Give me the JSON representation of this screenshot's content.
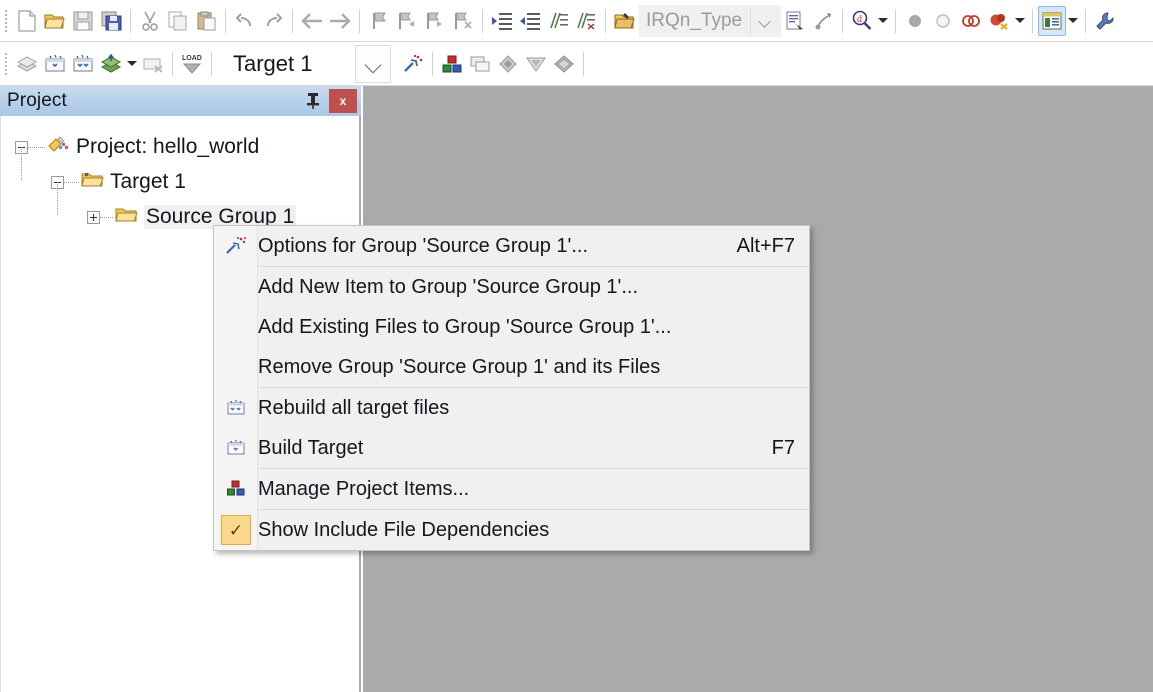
{
  "toolbar_top": {
    "buttons": [
      {
        "name": "new-file-icon",
        "label": "New"
      },
      {
        "name": "open-file-icon",
        "label": "Open"
      },
      {
        "name": "save-icon",
        "label": "Save"
      },
      {
        "name": "save-all-icon",
        "label": "Save All"
      },
      {
        "name": "cut-icon",
        "label": "Cut"
      },
      {
        "name": "copy-icon",
        "label": "Copy"
      },
      {
        "name": "paste-icon",
        "label": "Paste"
      },
      {
        "name": "undo-icon",
        "label": "Undo"
      },
      {
        "name": "redo-icon",
        "label": "Redo"
      },
      {
        "name": "navigate-back-icon",
        "label": "Back"
      },
      {
        "name": "navigate-forward-icon",
        "label": "Forward"
      },
      {
        "name": "bookmark-toggle-icon",
        "label": "Insert/Remove Bookmark"
      },
      {
        "name": "bookmark-prev-icon",
        "label": "Previous Bookmark"
      },
      {
        "name": "bookmark-next-icon",
        "label": "Next Bookmark"
      },
      {
        "name": "bookmark-clear-icon",
        "label": "Clear All Bookmarks"
      },
      {
        "name": "indent-right-icon",
        "label": "Indent Selected Text"
      },
      {
        "name": "indent-left-icon",
        "label": "Unindent Selected Text"
      },
      {
        "name": "comment-icon",
        "label": "Comment Selection"
      },
      {
        "name": "uncomment-icon",
        "label": "Uncomment Selection"
      },
      {
        "name": "open-browse-icon",
        "label": "Browse"
      }
    ],
    "symbol_combo": {
      "value": "IRQn_Type",
      "dropdown_name": "symbol-dropdown-arrow"
    },
    "after_combo_buttons": [
      {
        "name": "goto-definition-icon",
        "label": "Go To Definition"
      },
      {
        "name": "back-to-reference-icon",
        "label": "Back to Reference"
      }
    ],
    "find_button": {
      "name": "find-in-files-icon",
      "label": "Find in Files"
    },
    "debug_buttons": [
      {
        "name": "breakpoint-disabled-icon",
        "label": "Insert/Remove Breakpoint"
      },
      {
        "name": "breakpoint-toggle-icon",
        "label": "Enable/Disable Breakpoint"
      },
      {
        "name": "breakpoints-disable-all-icon",
        "label": "Disable All Breakpoints"
      },
      {
        "name": "breakpoints-kill-all-icon",
        "label": "Kill All Breakpoints"
      }
    ],
    "window-manager-button": {
      "name": "manage-windows-icon",
      "label": "Manage Windows",
      "active": true
    },
    "configure-button": {
      "name": "configure-wrench-icon",
      "label": "Configuration Wizard"
    }
  },
  "toolbar_second": {
    "buttons": [
      {
        "name": "translate-icon",
        "label": "Translate"
      },
      {
        "name": "build-icon",
        "label": "Build"
      },
      {
        "name": "rebuild-icon",
        "label": "Rebuild"
      },
      {
        "name": "batch-build-icon",
        "label": "Batch Build"
      },
      {
        "name": "stop-build-icon",
        "label": "Stop Build"
      },
      {
        "name": "download-icon",
        "label": "Download"
      }
    ],
    "target_combo": {
      "value": "Target 1",
      "dropdown_name": "target-dropdown-arrow"
    },
    "after_target_buttons": [
      {
        "name": "target-options-icon",
        "label": "Options for Target"
      },
      {
        "name": "manage-project-items-icon",
        "label": "Manage Project Items"
      },
      {
        "name": "multi-project-icon",
        "label": "Multi-Project"
      },
      {
        "name": "pack-installer-icon",
        "label": "Pack Installer"
      },
      {
        "name": "manage-run-time-env-icon",
        "label": "Manage Run-Time Environment"
      },
      {
        "name": "select-software-packs-icon",
        "label": "Select Software Packs"
      }
    ]
  },
  "project_panel": {
    "title": "Project",
    "pin_icon": "pin-icon",
    "close_label": "x",
    "tree": [
      {
        "label": "Project: hello_world",
        "icon": "project-icon",
        "expander": "minus",
        "level": 0
      },
      {
        "label": "Target 1",
        "icon": "target-folder-icon",
        "expander": "minus",
        "level": 1
      },
      {
        "label": "Source Group 1",
        "icon": "folder-icon",
        "expander": "plus",
        "level": 2,
        "selected": true
      }
    ]
  },
  "context_menu": {
    "items": [
      {
        "label": "Options for Group 'Source Group 1'...",
        "shortcut": "Alt+F7",
        "icon": "options-wand-icon",
        "type": "item"
      },
      {
        "type": "separator"
      },
      {
        "label": "Add New  Item to Group 'Source Group 1'...",
        "shortcut": "",
        "icon": "",
        "type": "item"
      },
      {
        "label": "Add Existing Files to Group 'Source Group 1'...",
        "shortcut": "",
        "icon": "",
        "type": "item"
      },
      {
        "label": "Remove Group 'Source Group 1' and its Files",
        "shortcut": "",
        "icon": "",
        "type": "item"
      },
      {
        "type": "separator"
      },
      {
        "label": "Rebuild all target files",
        "shortcut": "",
        "icon": "rebuild-icon",
        "type": "item"
      },
      {
        "label": "Build Target",
        "shortcut": "F7",
        "icon": "build-icon",
        "type": "item"
      },
      {
        "type": "separator"
      },
      {
        "label": "Manage Project Items...",
        "shortcut": "",
        "icon": "manage-project-items-icon",
        "type": "item"
      },
      {
        "type": "separator"
      },
      {
        "label": "Show Include File Dependencies",
        "shortcut": "",
        "icon": "checkmark-icon",
        "type": "checked",
        "checkmark": "✓"
      }
    ]
  },
  "colors": {
    "titlebar_accent": "#b7d0ea",
    "close_button": "#c0504d",
    "editor_background": "#aaaaaa",
    "menu_background": "#f0f0f0",
    "checked_highlight": "#fbd98c"
  }
}
